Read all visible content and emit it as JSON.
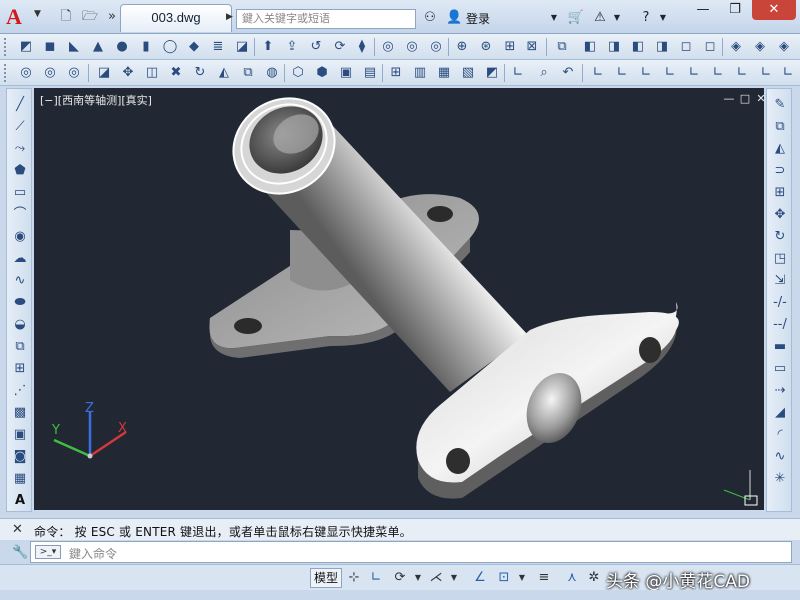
{
  "app": {
    "logo": "A",
    "document_tab": "003.dwg",
    "search_placeholder": "鍵入关键字或短语",
    "login": "登录"
  },
  "viewport": {
    "label": "[−][西南等轴测][真实]",
    "controls": [
      "—",
      "□",
      "✕"
    ],
    "ucs": {
      "x": "X",
      "y": "Y",
      "z": "Z"
    }
  },
  "command": {
    "history": "命令： 按 ESC 或 ENTER 键退出，或者单击鼠标右键显示快捷菜单。",
    "placeholder": "鍵入命令"
  },
  "status": {
    "model_label": "模型"
  },
  "watermark": "头条 @小黄花CAD",
  "colors": {
    "viewport_bg": "#212833",
    "ucs_x": "#d23a3a",
    "ucs_y": "#3fbf3f",
    "ucs_z": "#3a6fe0"
  }
}
